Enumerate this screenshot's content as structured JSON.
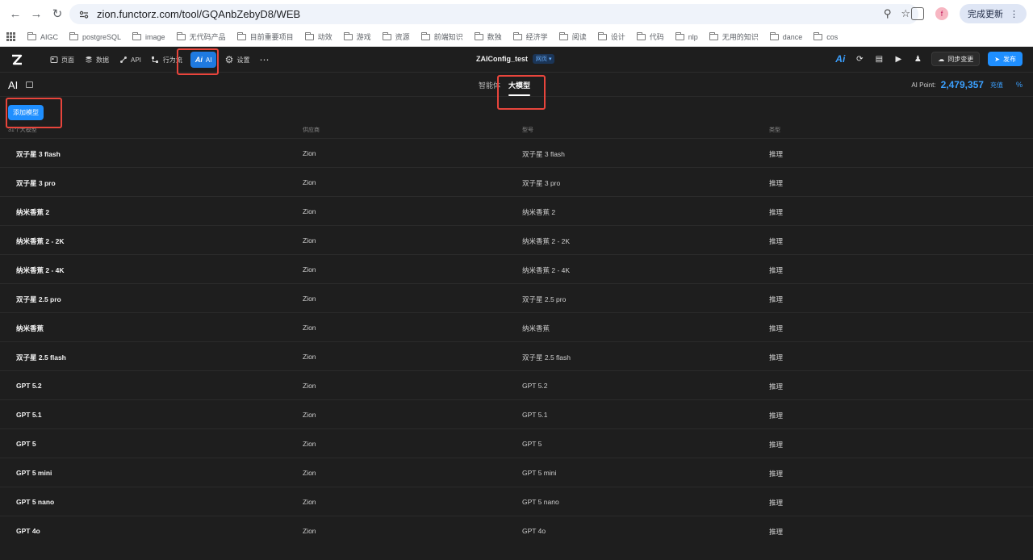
{
  "browser": {
    "url": "zion.functorz.com/tool/GQAnbZebyD8/WEB",
    "update_label": "完成更新",
    "profile_initial": "f",
    "bookmarks": [
      "AIGC",
      "postgreSQL",
      "image",
      "无代码产品",
      "目前重要项目",
      "动效",
      "游戏",
      "资源",
      "前端知识",
      "数独",
      "经济学",
      "阅读",
      "设计",
      "代码",
      "nlp",
      "无用的知识",
      "dance",
      "cos"
    ]
  },
  "header": {
    "nav": {
      "pages": "页面",
      "data": "数据",
      "api": "API",
      "flow": "行为流",
      "ai": "AI",
      "settings": "设置"
    },
    "project_name": "ZAIConfig_test",
    "project_tag": "网页",
    "sync_label": "同步变更",
    "publish_label": "发布"
  },
  "subheader": {
    "title": "AI",
    "tabs": {
      "agent": "智能体",
      "model": "大模型"
    },
    "points_label": "AI Point:",
    "points_value": "2,479,357",
    "recharge_label": "充值",
    "pct_icon": "%"
  },
  "content": {
    "add_button": "添加模型",
    "count_label": "31个大模型",
    "columns": {
      "provider": "供应商",
      "model": "型号",
      "type": "类型"
    },
    "rows": [
      {
        "name": "双子星 3 flash",
        "provider": "Zion",
        "model": "双子星 3 flash",
        "type": "推理"
      },
      {
        "name": "双子星 3 pro",
        "provider": "Zion",
        "model": "双子星 3 pro",
        "type": "推理"
      },
      {
        "name": "纳米香蕉 2",
        "provider": "Zion",
        "model": "纳米香蕉 2",
        "type": "推理"
      },
      {
        "name": "纳米香蕉 2 - 2K",
        "provider": "Zion",
        "model": "纳米香蕉 2 - 2K",
        "type": "推理"
      },
      {
        "name": "纳米香蕉 2 - 4K",
        "provider": "Zion",
        "model": "纳米香蕉 2 - 4K",
        "type": "推理"
      },
      {
        "name": "双子星 2.5 pro",
        "provider": "Zion",
        "model": "双子星 2.5 pro",
        "type": "推理"
      },
      {
        "name": "纳米香蕉",
        "provider": "Zion",
        "model": "纳米香蕉",
        "type": "推理"
      },
      {
        "name": "双子星 2.5 flash",
        "provider": "Zion",
        "model": "双子星 2.5 flash",
        "type": "推理"
      },
      {
        "name": "GPT 5.2",
        "provider": "Zion",
        "model": "GPT 5.2",
        "type": "推理"
      },
      {
        "name": "GPT 5.1",
        "provider": "Zion",
        "model": "GPT 5.1",
        "type": "推理"
      },
      {
        "name": "GPT 5",
        "provider": "Zion",
        "model": "GPT 5",
        "type": "推理"
      },
      {
        "name": "GPT 5 mini",
        "provider": "Zion",
        "model": "GPT 5 mini",
        "type": "推理"
      },
      {
        "name": "GPT 5 nano",
        "provider": "Zion",
        "model": "GPT 5 nano",
        "type": "推理"
      },
      {
        "name": "GPT 4o",
        "provider": "Zion",
        "model": "GPT 4o",
        "type": "推理"
      }
    ]
  },
  "colors": {
    "accent": "#1f8fff",
    "highlight": "#e8453c",
    "background": "#1e1e1e"
  }
}
